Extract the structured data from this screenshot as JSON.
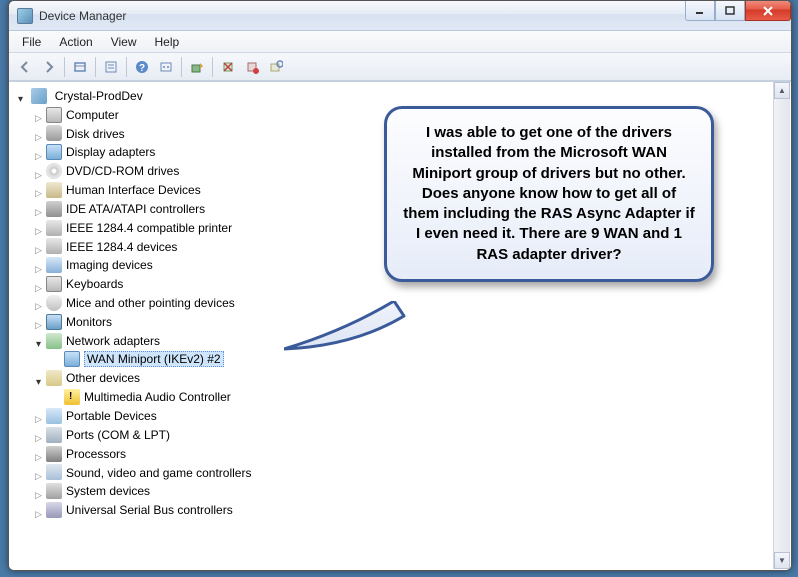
{
  "window": {
    "title": "Device Manager"
  },
  "menu": {
    "file": "File",
    "action": "Action",
    "view": "View",
    "help": "Help"
  },
  "tree": {
    "root": "Crystal-ProdDev",
    "items": [
      "Computer",
      "Disk drives",
      "Display adapters",
      "DVD/CD-ROM drives",
      "Human Interface Devices",
      "IDE ATA/ATAPI controllers",
      "IEEE 1284.4 compatible printer",
      "IEEE 1284.4 devices",
      "Imaging devices",
      "Keyboards",
      "Mice and other pointing devices",
      "Monitors",
      "Network adapters",
      "Other devices",
      "Portable Devices",
      "Ports (COM & LPT)",
      "Processors",
      "Sound, video and game controllers",
      "System devices",
      "Universal Serial Bus controllers"
    ],
    "network_child": "WAN Miniport (IKEv2) #2",
    "other_child": "Multimedia Audio Controller"
  },
  "callout": {
    "text": "I was able to get one of the drivers installed from the Microsoft WAN Miniport group of drivers but no other. Does anyone know how to get all of them including the RAS Async Adapter if I even need it. There are 9 WAN and 1 RAS adapter driver?"
  }
}
